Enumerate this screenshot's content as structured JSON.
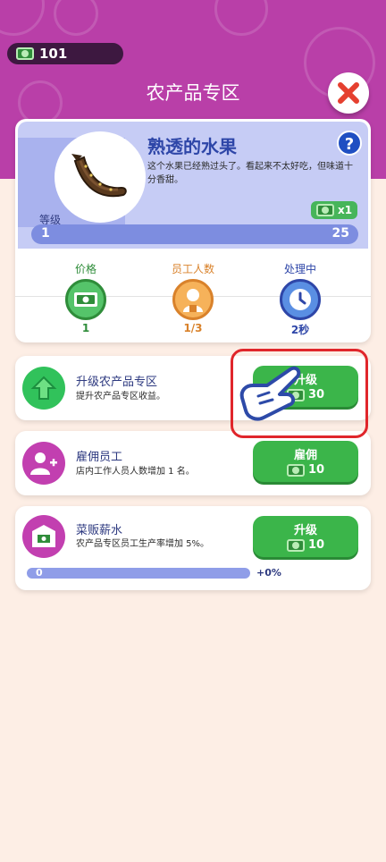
{
  "header": {
    "wallet_value": "101",
    "title": "农产品专区",
    "colors": {
      "background": "#b93fa8",
      "wallet_bg": "#3d1840"
    }
  },
  "product": {
    "name": "熟透的水果",
    "description": "这个水果已经熟过头了。看起来不太好吃，但味道十分香甜。",
    "multiplier": "x1",
    "level_label": "等级",
    "level_current": "1",
    "level_max": "25",
    "level_progress": 0.0
  },
  "stats": {
    "price": {
      "label": "价格",
      "value": "1",
      "icon": "cash-icon"
    },
    "staff": {
      "label": "员工人数",
      "value": "1/3",
      "icon": "worker-icon"
    },
    "processing": {
      "label": "处理中",
      "value": "2秒",
      "icon": "clock-icon"
    }
  },
  "upgrades": [
    {
      "title": "升级农产品专区",
      "desc": "提升农产品专区收益。",
      "button": "升级",
      "cost": "30",
      "icon": "upgrade-arrow-icon"
    },
    {
      "title": "雇佣员工",
      "desc": "店内工作人员人数增加 1 名。",
      "button": "雇佣",
      "cost": "10",
      "icon": "add-worker-icon"
    },
    {
      "title": "菜贩薪水",
      "desc": "农产品专区员工生产率增加 5%。",
      "button": "升级",
      "cost": "10",
      "icon": "salary-envelope-icon",
      "bar_value": "0",
      "bar_bonus": "+0%"
    }
  ],
  "colors": {
    "accent_green": "#3bb54a",
    "accent_blue": "#2e46a8",
    "highlight_red": "#e0262b"
  }
}
